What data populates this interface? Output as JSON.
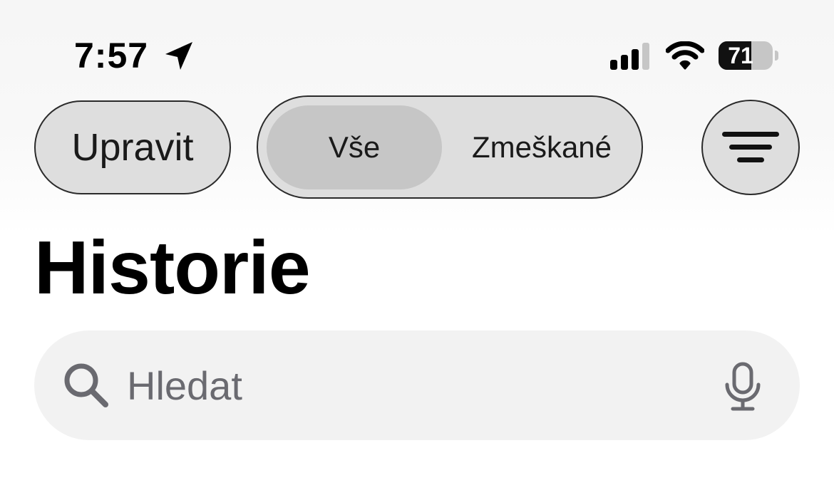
{
  "status_bar": {
    "time": "7:57",
    "battery_percent": 71,
    "battery_label": "71",
    "icons": [
      "location-arrow-icon",
      "cellular-signal-icon",
      "wifi-icon",
      "battery-icon"
    ]
  },
  "toolbar": {
    "edit_label": "Upravit",
    "segments": [
      {
        "label": "Vše",
        "selected": true
      },
      {
        "label": "Zmeškané",
        "selected": false
      }
    ],
    "filter_icon": "filter-lines-icon"
  },
  "page": {
    "title": "Historie"
  },
  "search": {
    "placeholder": "Hledat",
    "value": "",
    "search_icon": "magnifier-icon",
    "mic_icon": "microphone-icon"
  },
  "colors": {
    "control_fill": "#dedede",
    "segment_selected": "#c6c6c6",
    "search_fill": "#f2f2f2",
    "placeholder_text": "#6a6a70"
  }
}
